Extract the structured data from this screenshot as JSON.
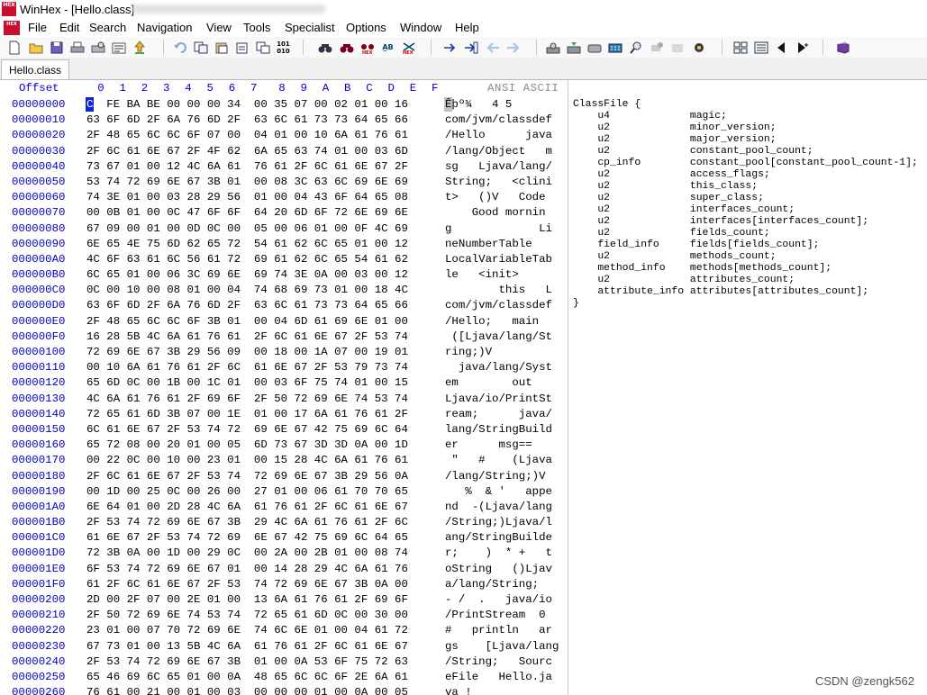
{
  "window": {
    "title": "WinHex - [Hello.class]",
    "logo_text": "HEX"
  },
  "menu": [
    "File",
    "Edit",
    "Search",
    "Navigation",
    "View",
    "Tools",
    "Specialist",
    "Options",
    "Window",
    "Help"
  ],
  "toolbar_icons": [
    "new-file-icon",
    "open-file-icon",
    "save-icon",
    "print-icon",
    "print-preview-icon",
    "properties-icon",
    "export-icon",
    "undo-icon",
    "copy-block-icon",
    "paste-icon",
    "clipboard-icon",
    "write-clipboard-icon",
    "convert-icon",
    "find-text-icon",
    "find-hex-icon",
    "find-hex-values-icon",
    "replace-text-icon",
    "replace-hex-icon",
    "goto-offset-icon",
    "goto-position-icon",
    "back-arrow-icon",
    "forward-arrow-icon",
    "open-disk-icon",
    "open-ram-icon",
    "disk-tools-icon",
    "calculator-icon",
    "search-icon",
    "hash-icon",
    "settings-gear-icon",
    "position-manager-icon",
    "data-interpreter-icon",
    "prev-block-icon",
    "next-block-icon",
    "help-book-icon"
  ],
  "tab": {
    "label": "Hello.class"
  },
  "hex_view": {
    "offset_header": "Offset",
    "column_headers": [
      "0",
      "1",
      "2",
      "3",
      "4",
      "5",
      "6",
      "7",
      "8",
      "9",
      "A",
      "B",
      "C",
      "D",
      "E",
      "F"
    ],
    "ansi_header": "ANSI ASCII",
    "rows": [
      {
        "offset": "00000000",
        "hex": "CA FE BA BE 00 00 00 34  00 35 07 00 02 01 00 16",
        "ascii": "Êþº¾   4 5"
      },
      {
        "offset": "00000010",
        "hex": "63 6F 6D 2F 6A 76 6D 2F  63 6C 61 73 73 64 65 66",
        "ascii": "com/jvm/classdef"
      },
      {
        "offset": "00000020",
        "hex": "2F 48 65 6C 6C 6F 07 00  04 01 00 10 6A 61 76 61",
        "ascii": "/Hello      java"
      },
      {
        "offset": "00000030",
        "hex": "2F 6C 61 6E 67 2F 4F 62  6A 65 63 74 01 00 03 6D",
        "ascii": "/lang/Object   m"
      },
      {
        "offset": "00000040",
        "hex": "73 67 01 00 12 4C 6A 61  76 61 2F 6C 61 6E 67 2F",
        "ascii": "sg   Ljava/lang/"
      },
      {
        "offset": "00000050",
        "hex": "53 74 72 69 6E 67 3B 01  00 08 3C 63 6C 69 6E 69",
        "ascii": "String;   <clini"
      },
      {
        "offset": "00000060",
        "hex": "74 3E 01 00 03 28 29 56  01 00 04 43 6F 64 65 08",
        "ascii": "t>   ()V   Code "
      },
      {
        "offset": "00000070",
        "hex": "00 0B 01 00 0C 47 6F 6F  64 20 6D 6F 72 6E 69 6E",
        "ascii": "    Good mornin"
      },
      {
        "offset": "00000080",
        "hex": "67 09 00 01 00 0D 0C 00  05 00 06 01 00 0F 4C 69",
        "ascii": "g             Li"
      },
      {
        "offset": "00000090",
        "hex": "6E 65 4E 75 6D 62 65 72  54 61 62 6C 65 01 00 12",
        "ascii": "neNumberTable"
      },
      {
        "offset": "000000A0",
        "hex": "4C 6F 63 61 6C 56 61 72  69 61 62 6C 65 54 61 62",
        "ascii": "LocalVariableTab"
      },
      {
        "offset": "000000B0",
        "hex": "6C 65 01 00 06 3C 69 6E  69 74 3E 0A 00 03 00 12",
        "ascii": "le   <init>"
      },
      {
        "offset": "000000C0",
        "hex": "0C 00 10 00 08 01 00 04  74 68 69 73 01 00 18 4C",
        "ascii": "        this   L"
      },
      {
        "offset": "000000D0",
        "hex": "63 6F 6D 2F 6A 76 6D 2F  63 6C 61 73 73 64 65 66",
        "ascii": "com/jvm/classdef"
      },
      {
        "offset": "000000E0",
        "hex": "2F 48 65 6C 6C 6F 3B 01  00 04 6D 61 69 6E 01 00",
        "ascii": "/Hello;   main"
      },
      {
        "offset": "000000F0",
        "hex": "16 28 5B 4C 6A 61 76 61  2F 6C 61 6E 67 2F 53 74",
        "ascii": " ([Ljava/lang/St"
      },
      {
        "offset": "00000100",
        "hex": "72 69 6E 67 3B 29 56 09  00 18 00 1A 07 00 19 01",
        "ascii": "ring;)V"
      },
      {
        "offset": "00000110",
        "hex": "00 10 6A 61 76 61 2F 6C  61 6E 67 2F 53 79 73 74",
        "ascii": "  java/lang/Syst"
      },
      {
        "offset": "00000120",
        "hex": "65 6D 0C 00 1B 00 1C 01  00 03 6F 75 74 01 00 15",
        "ascii": "em        out"
      },
      {
        "offset": "00000130",
        "hex": "4C 6A 61 76 61 2F 69 6F  2F 50 72 69 6E 74 53 74",
        "ascii": "Ljava/io/PrintSt"
      },
      {
        "offset": "00000140",
        "hex": "72 65 61 6D 3B 07 00 1E  01 00 17 6A 61 76 61 2F",
        "ascii": "ream;      java/"
      },
      {
        "offset": "00000150",
        "hex": "6C 61 6E 67 2F 53 74 72  69 6E 67 42 75 69 6C 64",
        "ascii": "lang/StringBuild"
      },
      {
        "offset": "00000160",
        "hex": "65 72 08 00 20 01 00 05  6D 73 67 3D 3D 0A 00 1D",
        "ascii": "er      msg=="
      },
      {
        "offset": "00000170",
        "hex": "00 22 0C 00 10 00 23 01  00 15 28 4C 6A 61 76 61",
        "ascii": " \"   #    (Ljava"
      },
      {
        "offset": "00000180",
        "hex": "2F 6C 61 6E 67 2F 53 74  72 69 6E 67 3B 29 56 0A",
        "ascii": "/lang/String;)V"
      },
      {
        "offset": "00000190",
        "hex": "00 1D 00 25 0C 00 26 00  27 01 00 06 61 70 70 65",
        "ascii": "   %  & '   appe"
      },
      {
        "offset": "000001A0",
        "hex": "6E 64 01 00 2D 28 4C 6A  61 76 61 2F 6C 61 6E 67",
        "ascii": "nd  -(Ljava/lang"
      },
      {
        "offset": "000001B0",
        "hex": "2F 53 74 72 69 6E 67 3B  29 4C 6A 61 76 61 2F 6C",
        "ascii": "/String;)Ljava/l"
      },
      {
        "offset": "000001C0",
        "hex": "61 6E 67 2F 53 74 72 69  6E 67 42 75 69 6C 64 65",
        "ascii": "ang/StringBuilde"
      },
      {
        "offset": "000001D0",
        "hex": "72 3B 0A 00 1D 00 29 0C  00 2A 00 2B 01 00 08 74",
        "ascii": "r;    )  * +   t"
      },
      {
        "offset": "000001E0",
        "hex": "6F 53 74 72 69 6E 67 01  00 14 28 29 4C 6A 61 76",
        "ascii": "oString   ()Ljav"
      },
      {
        "offset": "000001F0",
        "hex": "61 2F 6C 61 6E 67 2F 53  74 72 69 6E 67 3B 0A 00",
        "ascii": "a/lang/String;"
      },
      {
        "offset": "00000200",
        "hex": "2D 00 2F 07 00 2E 01 00  13 6A 61 76 61 2F 69 6F",
        "ascii": "- /  .   java/io"
      },
      {
        "offset": "00000210",
        "hex": "2F 50 72 69 6E 74 53 74  72 65 61 6D 0C 00 30 00",
        "ascii": "/PrintStream  0"
      },
      {
        "offset": "00000220",
        "hex": "23 01 00 07 70 72 69 6E  74 6C 6E 01 00 04 61 72",
        "ascii": "#   println   ar"
      },
      {
        "offset": "00000230",
        "hex": "67 73 01 00 13 5B 4C 6A  61 76 61 2F 6C 61 6E 67",
        "ascii": "gs    [Ljava/lang"
      },
      {
        "offset": "00000240",
        "hex": "2F 53 74 72 69 6E 67 3B  01 00 0A 53 6F 75 72 63",
        "ascii": "/String;   Sourc"
      },
      {
        "offset": "00000250",
        "hex": "65 46 69 6C 65 01 00 0A  48 65 6C 6C 6F 2E 6A 61",
        "ascii": "eFile   Hello.ja"
      },
      {
        "offset": "00000260",
        "hex": "76 61 00 21 00 01 00 03  00 00 00 01 00 0A 00 05",
        "ascii": "va !"
      }
    ]
  },
  "classfile_text": "ClassFile {\n    u4             magic;\n    u2             minor_version;\n    u2             major_version;\n    u2             constant_pool_count;\n    cp_info        constant_pool[constant_pool_count-1];\n    u2             access_flags;\n    u2             this_class;\n    u2             super_class;\n    u2             interfaces_count;\n    u2             interfaces[interfaces_count];\n    u2             fields_count;\n    field_info     fields[fields_count];\n    u2             methods_count;\n    method_info    methods[methods_count];\n    u2             attributes_count;\n    attribute_info attributes[attributes_count];\n}",
  "watermark": "CSDN @zengk562"
}
